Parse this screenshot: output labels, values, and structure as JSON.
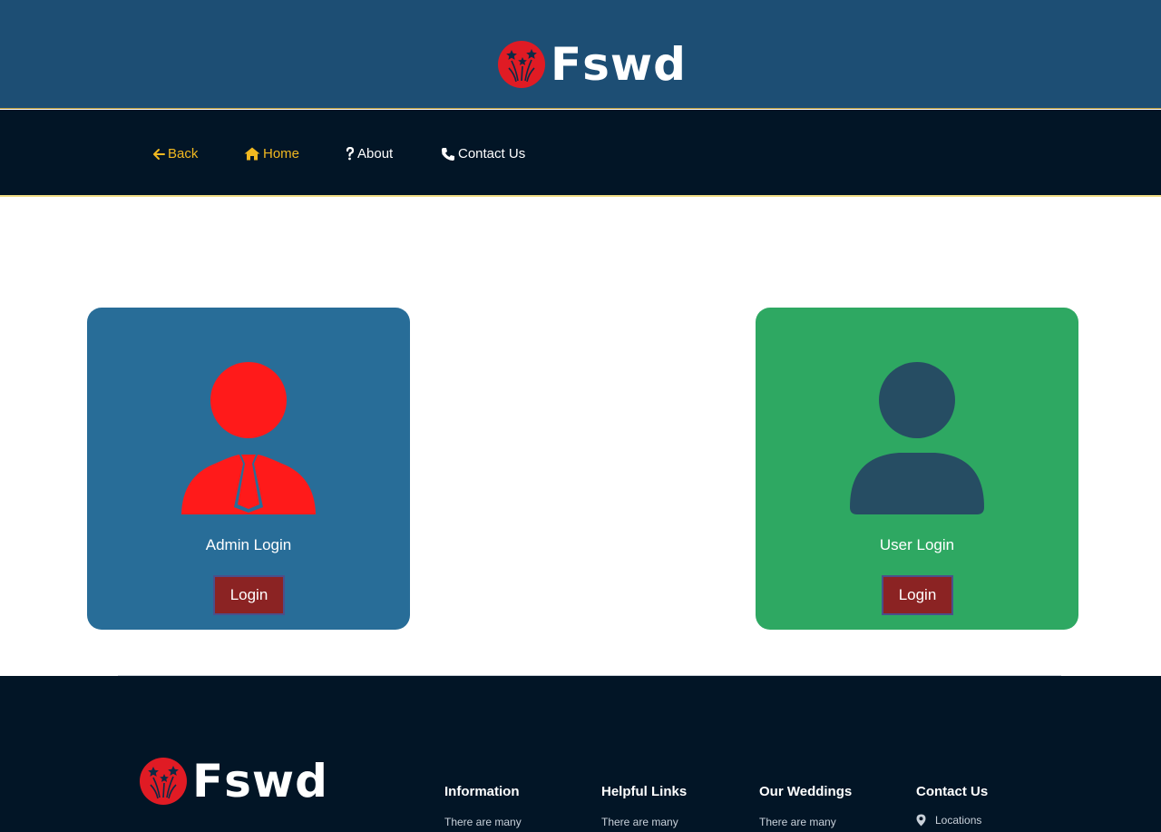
{
  "brand": {
    "name": "Fswd"
  },
  "nav": {
    "back": "Back",
    "home": "Home",
    "about": "About",
    "contact": "Contact Us"
  },
  "cards": {
    "admin": {
      "title": "Admin Login",
      "button": "Login"
    },
    "user": {
      "title": "User Login",
      "button": "Login"
    }
  },
  "footer": {
    "brand": "Fswd",
    "columns": [
      {
        "title": "Information",
        "text": "There are many"
      },
      {
        "title": "Helpful Links",
        "text": "There are many"
      },
      {
        "title": "Our Weddings",
        "text": "There are many"
      },
      {
        "title": "Contact Us",
        "text": "Locations"
      }
    ]
  },
  "colors": {
    "header_bg": "#1d4e74",
    "nav_bg": "#021526",
    "nav_gold": "#f1b820",
    "admin_card": "#286d98",
    "user_card": "#2ea862",
    "login_button": "#8b2323",
    "admin_icon": "#ff1a1a",
    "user_icon": "#264d63",
    "logo_red": "#e01b24"
  },
  "icons": {
    "logo": "fireworks-logo-icon",
    "back": "arrow-left-icon",
    "home": "home-icon",
    "about": "question-icon",
    "contact": "phone-icon",
    "admin": "admin-user-icon",
    "user": "user-icon",
    "location": "map-pin-icon"
  }
}
